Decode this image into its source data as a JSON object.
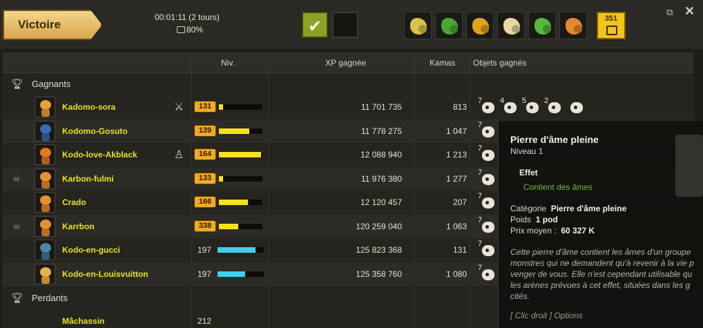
{
  "header": {
    "result": "Victoire",
    "duration": "00:01:11 (2 tours)",
    "pods_percent": "80%",
    "pods_count": "351",
    "loot_colors": [
      "#d9c24a",
      "#4aa832",
      "#e0a21c",
      "#e7d9a1",
      "#55b83a",
      "#e48a2a"
    ]
  },
  "columns": {
    "level": "Niv.",
    "xp": "XP gagnée",
    "kamas": "Kamas",
    "objects": "Objets gagnés"
  },
  "sections": {
    "winners": "Gagnants",
    "losers": "Perdants"
  },
  "winners": [
    {
      "name": "Kadomo-sora",
      "level": "131",
      "xp_fill": 0.1,
      "bar_color": "#f7e21a",
      "xp": "11 701 735",
      "kamas": "813",
      "role": "sword-icon",
      "skull": false,
      "head_color": "#e8a23c",
      "body_color": "#c07c2c"
    },
    {
      "name": "Kodomo-Gosuto",
      "level": "139",
      "xp_fill": 0.7,
      "bar_color": "#f7e21a",
      "xp": "11 778 275",
      "kamas": "1 047",
      "role": "",
      "skull": false,
      "head_color": "#3a6bb0",
      "body_color": "#2e4f7e"
    },
    {
      "name": "Kodo-love-Akblack",
      "level": "164",
      "xp_fill": 0.97,
      "bar_color": "#f7e21a",
      "xp": "12 088 940",
      "kamas": "1 213",
      "role": "person-icon",
      "skull": false,
      "head_color": "#e07a22",
      "body_color": "#b55a18"
    },
    {
      "name": "Karbon-fulmi",
      "level": "133",
      "xp_fill": 0.1,
      "bar_color": "#f7e21a",
      "xp": "11 976 380",
      "kamas": "1 277",
      "role": "",
      "skull": true,
      "head_color": "#e4922c",
      "body_color": "#bb6b1f"
    },
    {
      "name": "Crado",
      "level": "166",
      "xp_fill": 0.66,
      "bar_color": "#f7e21a",
      "xp": "12 120 457",
      "kamas": "207",
      "role": "",
      "skull": false,
      "head_color": "#e4922c",
      "body_color": "#bb6b1f"
    },
    {
      "name": "Karrbon",
      "level": "338",
      "xp_fill": 0.45,
      "bar_color": "#f7e21a",
      "xp": "120 259 040",
      "kamas": "1 063",
      "role": "",
      "skull": true,
      "head_color": "#e4922c",
      "body_color": "#bb6b1f"
    },
    {
      "name": "Kodo-en-gucci",
      "level": "197",
      "xp_fill": 0.82,
      "bar_color": "#3fd0ee",
      "xp": "125 823 368",
      "kamas": "131",
      "role": "",
      "skull": false,
      "head_color": "#4a87a8",
      "body_color": "#2f5e76"
    },
    {
      "name": "Kodo-en-Louisvuitton",
      "level": "197",
      "xp_fill": 0.6,
      "bar_color": "#3fd0ee",
      "xp": "125 358 760",
      "kamas": "1 080",
      "role": "",
      "skull": false,
      "head_color": "#e9b04a",
      "body_color": "#c48a2e"
    }
  ],
  "losers": [
    {
      "name": "Mâchassin",
      "level": "212"
    }
  ],
  "first_row_objects": [
    {
      "qty": "7",
      "kind": "soul-stone-icon"
    },
    {
      "qty": "4",
      "kind": "bone-icon"
    },
    {
      "qty": "5",
      "kind": "scroll-icon"
    },
    {
      "qty": "2",
      "kind": "key-icon"
    },
    {
      "qty": "",
      "kind": "helmet-icon"
    }
  ],
  "tooltip": {
    "title": "Pierre d'âme pleine",
    "level": "Niveau  1",
    "effect_title": "Effet",
    "effect": "Contient des âmes",
    "category_label": "Catégorie",
    "category": "Pierre d'âme pleine",
    "weight_label": "Poids",
    "weight": "1 pod",
    "price_label": "Prix moyen :",
    "price": "60 327 K",
    "description": [
      "Cette pierre d'âme contient les âmes d'un groupe",
      "monstres qui ne demandent qu'à revenir à la vie p",
      "venger de vous. Elle n'est cependant utilisable qu",
      "les arènes prévues à cet effet, situées dans les g",
      "cités."
    ],
    "hint": "[ Clic droit ] Options"
  }
}
